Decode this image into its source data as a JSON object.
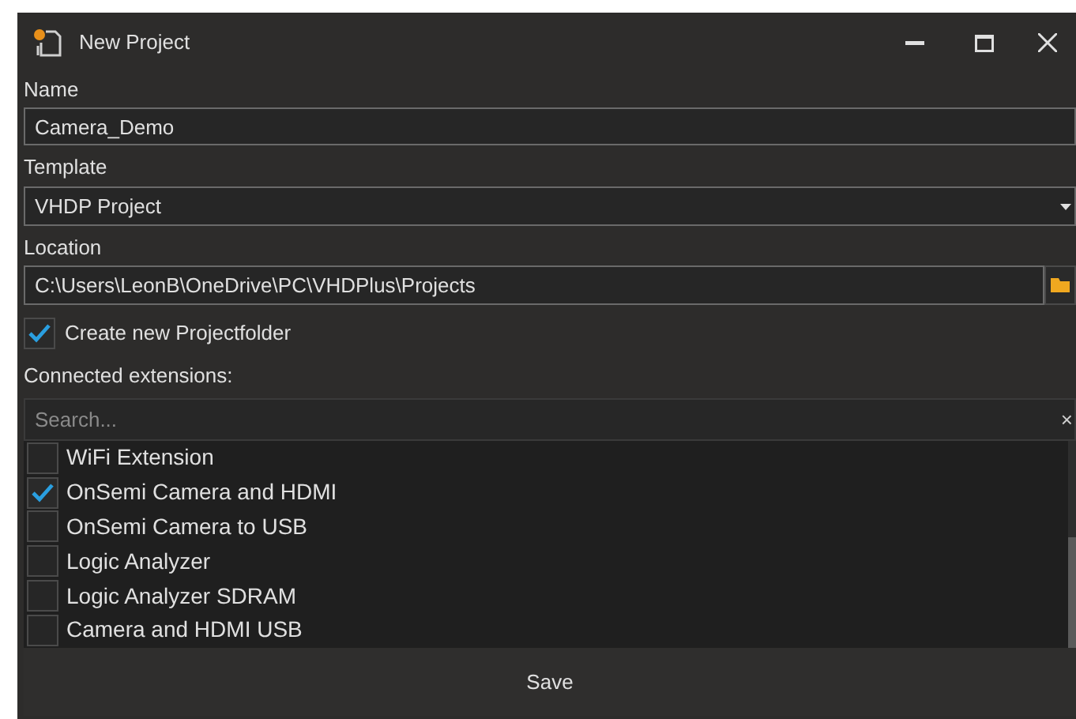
{
  "window": {
    "title": "New Project"
  },
  "name": {
    "label": "Name",
    "value": "Camera_Demo"
  },
  "template": {
    "label": "Template",
    "value": "VHDP Project"
  },
  "location": {
    "label": "Location",
    "value": "C:\\Users\\LeonB\\OneDrive\\PC\\VHDPlus\\Projects"
  },
  "create_folder": {
    "label": "Create new Projectfolder",
    "checked": true
  },
  "extensions": {
    "label": "Connected extensions:",
    "search": {
      "placeholder": "Search...",
      "clear": "×"
    },
    "items": [
      {
        "label": "WiFi Extension",
        "checked": false
      },
      {
        "label": "OnSemi Camera and HDMI",
        "checked": true
      },
      {
        "label": "OnSemi Camera to USB",
        "checked": false
      },
      {
        "label": "Logic Analyzer",
        "checked": false
      },
      {
        "label": "Logic Analyzer SDRAM",
        "checked": false
      },
      {
        "label": "Camera and HDMI USB",
        "checked": false
      }
    ]
  },
  "buttons": [
    "Save"
  ]
}
